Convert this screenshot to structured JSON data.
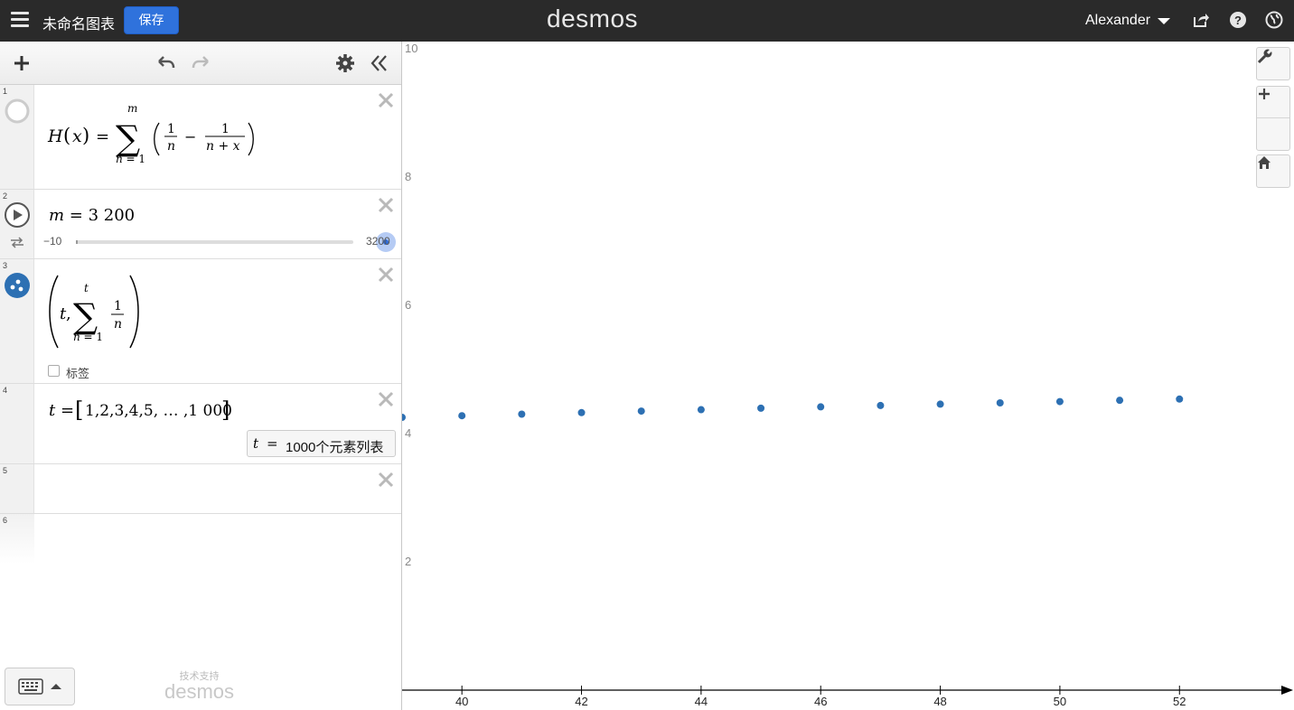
{
  "header": {
    "graph_title": "未命名图表",
    "save_label": "保存",
    "logo": "desmos",
    "user_name": "Alexander"
  },
  "expressions": [
    {
      "index": "1"
    },
    {
      "index": "2",
      "slider_min": "−10",
      "slider_max": "3200"
    },
    {
      "index": "3",
      "label_toggle": "标签"
    },
    {
      "index": "4",
      "eval_text": "1000个元素列表"
    },
    {
      "index": "5"
    },
    {
      "index": "6"
    }
  ],
  "footer": {
    "powered_by": "技术支持",
    "brand": "desmos"
  },
  "colors": {
    "header_bg": "#2a2a2a",
    "save_button": "#2f72dc",
    "point_color": "#2d70b3"
  },
  "chart_data": {
    "type": "scatter",
    "x_ticks": [
      "40",
      "42",
      "44",
      "46",
      "48",
      "50",
      "52"
    ],
    "y_ticks": [
      "2",
      "4",
      "6",
      "8",
      "10"
    ],
    "xlim": [
      39,
      53
    ],
    "ylim": [
      0,
      10
    ],
    "grid": false,
    "series": [
      {
        "x": [
          39,
          40,
          41,
          42,
          43,
          44,
          45,
          46,
          47,
          48,
          49,
          50,
          51,
          52
        ],
        "y": [
          4.253,
          4.279,
          4.303,
          4.327,
          4.351,
          4.373,
          4.396,
          4.417,
          4.438,
          4.459,
          4.479,
          4.499,
          4.519,
          4.538
        ]
      }
    ]
  }
}
